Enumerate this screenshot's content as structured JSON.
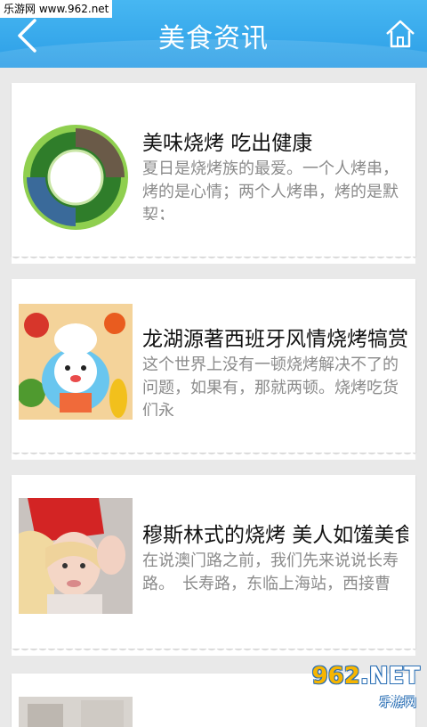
{
  "watermark": "乐游网 www.962.net",
  "header": {
    "title": "美食资讯"
  },
  "articles": [
    {
      "title": "美味烧烤 吃出健康",
      "summary": "夏日是烧烤族的最爱。一个人烤串，烤的是心情；两个人烤串，烤的是默契；"
    },
    {
      "title": "龙湖源著西班牙风情烧烤犒赏",
      "summary": "这个世界上没有一顿烧烤解决不了的问题，如果有，那就两顿。烧烤吃货们永"
    },
    {
      "title": "穆斯林式的烧烤 美人如馐美食",
      "summary": "在说澳门路之前，我们先来说说长寿路。　长寿路，东临上海站，西接曹"
    },
    {
      "title": "",
      "summary": ""
    }
  ],
  "corner_logo": {
    "number_a": "962",
    "number_b": ".NET",
    "subtitle": "乐游网"
  },
  "colors": {
    "header": "#2c9ee6",
    "background": "#e9e9e9"
  }
}
